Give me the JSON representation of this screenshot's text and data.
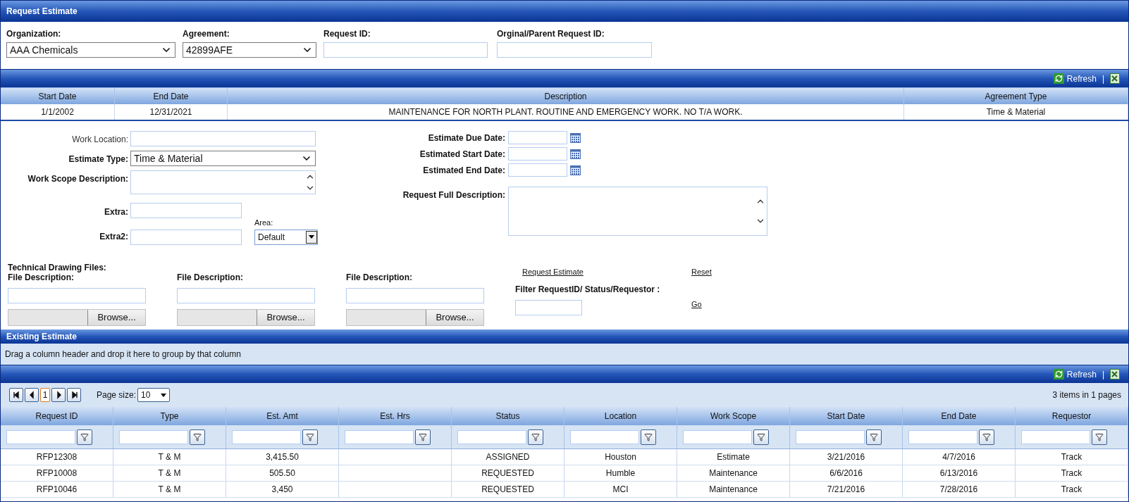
{
  "window": {
    "title": "Request Estimate"
  },
  "header_fields": [
    {
      "label": "Organization:",
      "kind": "dropdown",
      "value": "AAA Chemicals"
    },
    {
      "label": "Agreement:",
      "kind": "dropdown",
      "value": "42899AFE"
    },
    {
      "label": "Request ID:",
      "kind": "text"
    },
    {
      "label": "Orginal/Parent Request ID:",
      "kind": "text"
    }
  ],
  "agreement_toolbar": {
    "refresh": "Refresh",
    "separator": "|"
  },
  "agreement_table": {
    "columns": [
      "Start Date",
      "End Date",
      "Description",
      "Agreement Type"
    ],
    "rows": [
      [
        "1/1/2002",
        "12/31/2021",
        "MAINTENANCE FOR NORTH PLANT. ROUTINE AND EMERGENCY WORK. NO T/A WORK.",
        "Time & Material"
      ]
    ]
  },
  "estimate_form": {
    "left_fields": [
      {
        "label": "Work Location:",
        "kind": "text",
        "emphasized": false
      },
      {
        "label": "Estimate Type:",
        "kind": "dropdown",
        "value": "Time & Material",
        "emphasized": true
      },
      {
        "label": "Work Scope Description:",
        "kind": "textarea",
        "emphasized": true
      },
      {
        "label": "Extra:",
        "kind": "short",
        "emphasized": true
      },
      {
        "label": "Extra2:",
        "kind": "short",
        "emphasized": true
      }
    ],
    "area": {
      "label": "Area:",
      "value": "Default"
    },
    "date_fields": [
      "Estimate Due Date:",
      "Estimated Start Date:",
      "Estimated End Date:"
    ],
    "full_description": {
      "label": "Request Full Description:"
    }
  },
  "files": {
    "title": "Technical Drawing Files:",
    "items": [
      {
        "label": "File Description:",
        "button": "Browse..."
      },
      {
        "label": "File Description:",
        "button": "Browse..."
      },
      {
        "label": "File Description:",
        "button": "Browse..."
      }
    ]
  },
  "actions": {
    "request_estimate": "Request Estimate",
    "reset": "Reset",
    "filter_label": "Filter RequestID/ Status/Requestor :",
    "go": "Go"
  },
  "existing": {
    "title": "Existing Estimate",
    "group_hint": "Drag a column header and drop it here to group by that column",
    "refresh": "Refresh",
    "separator": "|",
    "pager": {
      "pages": [
        {
          "label": "1",
          "selected": true
        }
      ],
      "page_size_label": "Page size:",
      "page_size": "10",
      "summary": "3 items in 1 pages"
    },
    "columns": [
      "Request ID",
      "Type",
      "Est. Amt",
      "Est. Hrs",
      "Status",
      "Location",
      "Work Scope",
      "Start Date",
      "End Date",
      "Requestor"
    ],
    "rows": [
      [
        "RFP12308",
        "T & M",
        "3,415.50",
        null,
        "ASSIGNED",
        "Houston",
        "Estimate",
        "3/21/2016",
        "4/7/2016",
        "Track"
      ],
      [
        "RFP10008",
        "T & M",
        "505.50",
        null,
        "REQUESTED",
        "Humble",
        "Maintenance",
        "6/6/2016",
        "6/13/2016",
        "Track"
      ],
      [
        "RFP10046",
        "T & M",
        "3,450",
        null,
        "REQUESTED",
        "MCI",
        "Maintenance",
        "7/21/2016",
        "7/28/2016",
        "Track"
      ]
    ]
  }
}
